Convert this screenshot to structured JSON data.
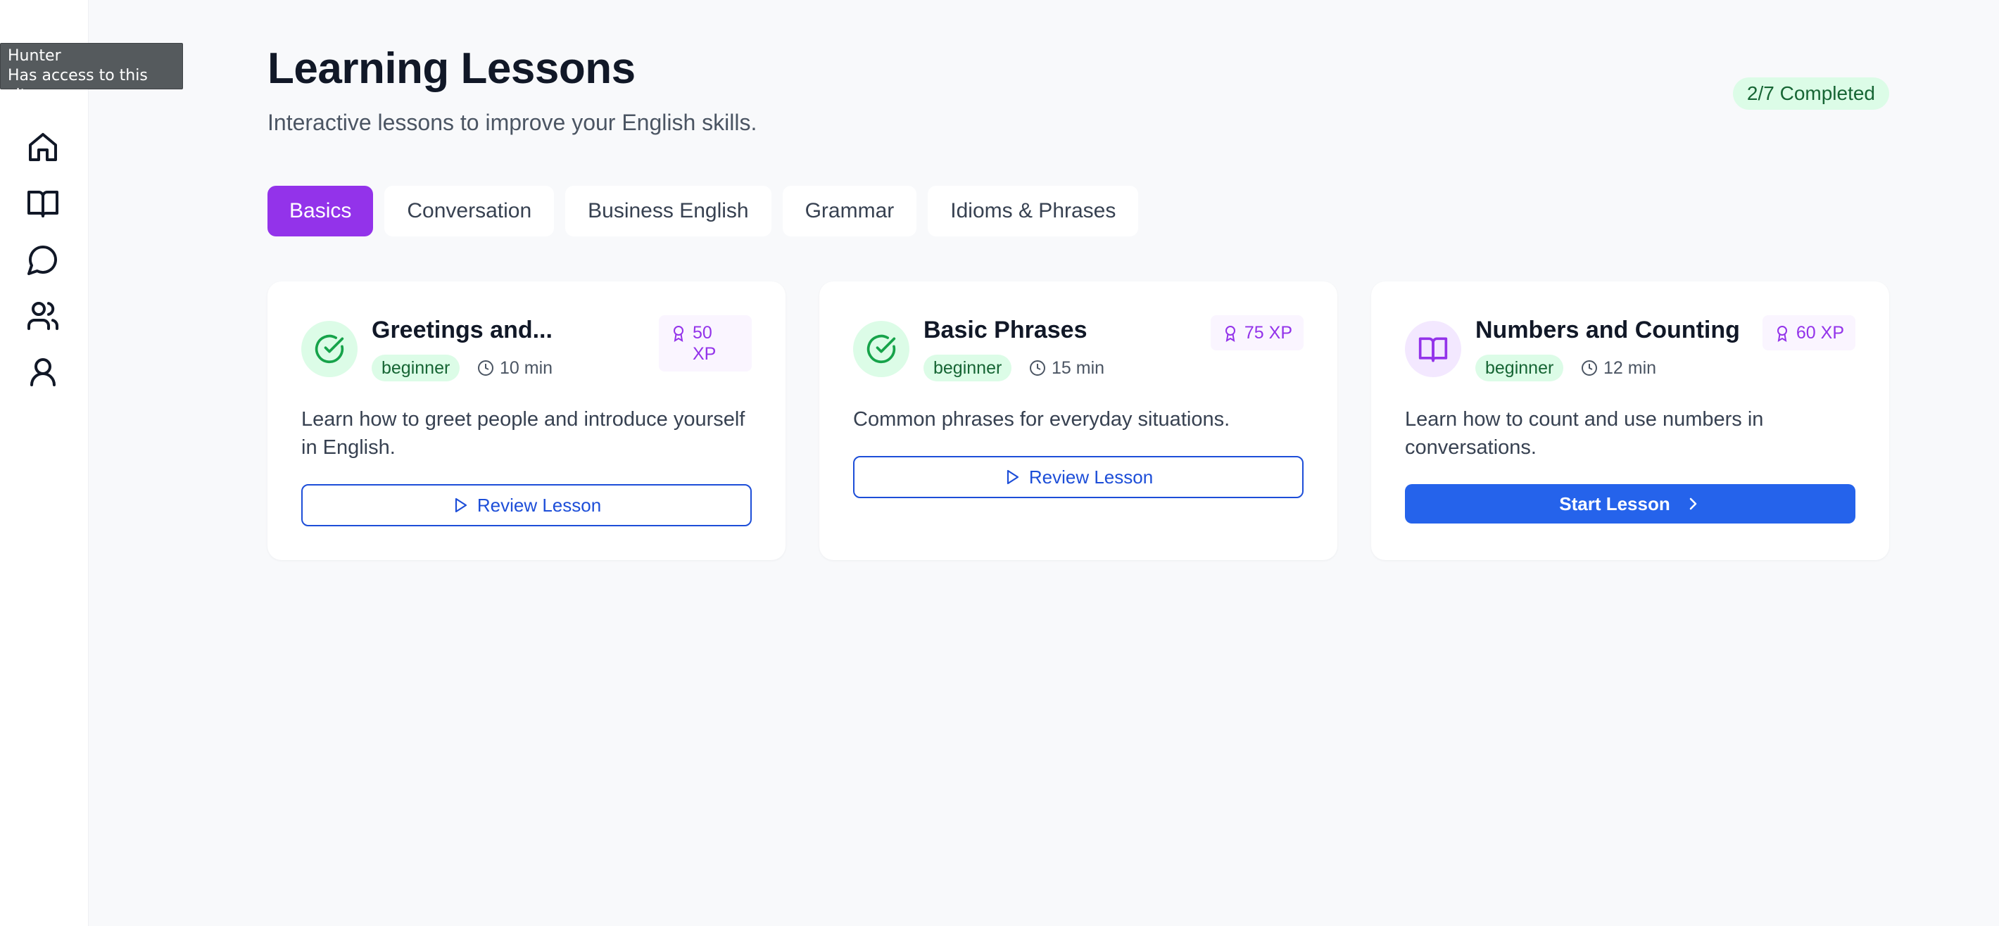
{
  "tooltip": {
    "name": "Hunter",
    "access": "Has access to this site"
  },
  "sidebar": {
    "items": [
      {
        "label": "home",
        "icon": "home-icon"
      },
      {
        "label": "lessons",
        "icon": "book-icon"
      },
      {
        "label": "chat",
        "icon": "message-circle-icon"
      },
      {
        "label": "community",
        "icon": "users-icon"
      },
      {
        "label": "profile",
        "icon": "user-icon"
      }
    ]
  },
  "header": {
    "title": "Learning Lessons",
    "subtitle": "Interactive lessons to improve your English skills.",
    "progress": "2/7 Completed"
  },
  "tabs": [
    {
      "label": "Basics",
      "active": true
    },
    {
      "label": "Conversation",
      "active": false
    },
    {
      "label": "Business English",
      "active": false
    },
    {
      "label": "Grammar",
      "active": false
    },
    {
      "label": "Idioms & Phrases",
      "active": false
    }
  ],
  "lessons": [
    {
      "title": "Greetings and...",
      "level": "beginner",
      "duration": "10 min",
      "xp": "50 XP",
      "status_icon": "check-circle-icon",
      "description": "Learn how to greet people and introduce yourself in English.",
      "button": "Review Lesson",
      "completed": true
    },
    {
      "title": "Basic Phrases",
      "level": "beginner",
      "duration": "15 min",
      "xp": "75 XP",
      "status_icon": "check-circle-icon",
      "description": "Common phrases for everyday situations.",
      "button": "Review Lesson",
      "completed": true
    },
    {
      "title": "Numbers and Counting",
      "level": "beginner",
      "duration": "12 min",
      "xp": "60 XP",
      "status_icon": "book-open-icon",
      "description": "Learn how to count and use numbers in conversations.",
      "button": "Start Lesson",
      "completed": false
    }
  ],
  "colors": {
    "accent": "#9333ea",
    "primary": "#2563eb",
    "success_bg": "#dcfce7",
    "success_text": "#166534"
  }
}
